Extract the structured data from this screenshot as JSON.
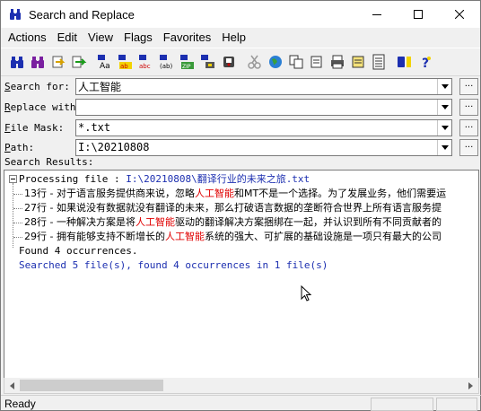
{
  "window": {
    "title": "Search and Replace"
  },
  "menu": [
    "Actions",
    "Edit",
    "View",
    "Flags",
    "Favorites",
    "Help"
  ],
  "toolbar_icons": [
    "find-icon",
    "find-in-files-icon",
    "replace-icon",
    "replace-in-files-icon",
    "case-sensitive-icon",
    "whole-word-icon",
    "regex-icon",
    "special-chars-icon",
    "zip-search-icon",
    "subfolders-icon",
    "disk-icon",
    "cut-icon",
    "globe-icon",
    "copy-icon",
    "delete-icon",
    "print-icon",
    "notes-icon",
    "list-icon",
    "favorites-search-icon",
    "help-icon"
  ],
  "search_for": {
    "label_u": "S",
    "label_rest": "earch for:",
    "value": "人工智能"
  },
  "replace_with": {
    "label_u": "R",
    "label_rest": "eplace with:",
    "value": ""
  },
  "file_mask": {
    "label_u": "F",
    "label_rest": "ile Mask:",
    "value": "*.txt"
  },
  "path": {
    "label_u": "P",
    "label_rest": "ath:",
    "value": "I:\\20210808"
  },
  "browse_label": "...",
  "results": {
    "label": "Search Results:",
    "processing_prefix": "Processing file : ",
    "processing_file": "I:\\20210808\\翻译行业的未来之旅.txt",
    "lines": [
      {
        "num": "13行",
        "pre": " - 对于语言服务提供商来说，忽略",
        "match": "人工智能",
        "post": "和MT不是一个选择。为了发展业务，他们需要运"
      },
      {
        "num": "27行",
        "pre": " - 如果说没有数据就没有翻译的未来，那么打破语言数据的垄断符合世界上所有语言服务提",
        "match": "",
        "post": ""
      },
      {
        "num": "28行",
        "pre": " - 一种解决方案是将",
        "match": "人工智能",
        "post": "驱动的翻译解决方案捆绑在一起，并认识到所有不同贡献者的"
      },
      {
        "num": "29行",
        "pre": " - 拥有能够支持不断增长的",
        "match": "人工智能",
        "post": "系统的强大、可扩展的基础设施是一项只有最大的公司"
      }
    ],
    "found": "Found 4 occurrences.",
    "summary": "Searched 5 file(s), found 4 occurrences in 1 file(s)"
  },
  "status": {
    "text": "Ready"
  }
}
